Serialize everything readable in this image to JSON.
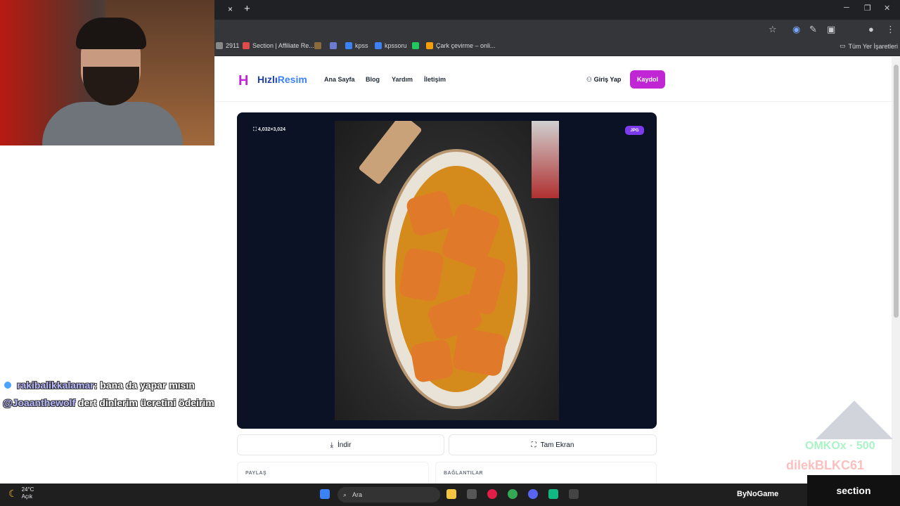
{
  "browser": {
    "tab_close_glyph": "×",
    "new_tab_glyph": "+",
    "bookmarks": [
      {
        "label": "2911",
        "color": "#888888"
      },
      {
        "label": "Section | Affiliate Re...",
        "color": "#e04a4a"
      },
      {
        "label": "",
        "color": "#8a6a3a"
      },
      {
        "label": "",
        "color": "#6b7bd0"
      },
      {
        "label": "kpss",
        "color": "#3b82f6"
      },
      {
        "label": "kpssoru",
        "color": "#3b82f6"
      },
      {
        "label": "",
        "color": "#22c55e"
      },
      {
        "label": "Çark çevirme – onli...",
        "color": "#f59e0b"
      }
    ],
    "bookmarks_folder": "Tüm Yer İşaretleri"
  },
  "chat": {
    "user1": "rakibalikkalamar",
    "msg1": ": bana da yapar mısın",
    "user2": "@Joaanthewolf",
    "msg2": " dert dinlerim ücretini ödeirim"
  },
  "site": {
    "logo_text_a": "Hızlı",
    "logo_text_b": "Resim",
    "nav": [
      "Ana Sayfa",
      "Blog",
      "Yardım",
      "İletişim"
    ],
    "login": "Giriş Yap",
    "signup": "Kaydol"
  },
  "viewer": {
    "dimensions": "4,032×3,024",
    "format_badge": "JPG"
  },
  "actions": {
    "download": "İndir",
    "fullscreen": "Tam Ekran"
  },
  "sections": {
    "share": "PAYLAŞ",
    "links": "BAĞLANTILAR"
  },
  "overlay": {
    "text1": "OMKOx · 500",
    "text2": "dilekBLKC61",
    "brand": "section"
  },
  "taskbar": {
    "temp": "24°C",
    "weather": "Açık",
    "search": "Ara",
    "brand": "ByNoGame"
  },
  "colors": {
    "accent": "#c026d3",
    "brand_blue": "#1e40af",
    "viewer_bg": "#0b1225"
  }
}
